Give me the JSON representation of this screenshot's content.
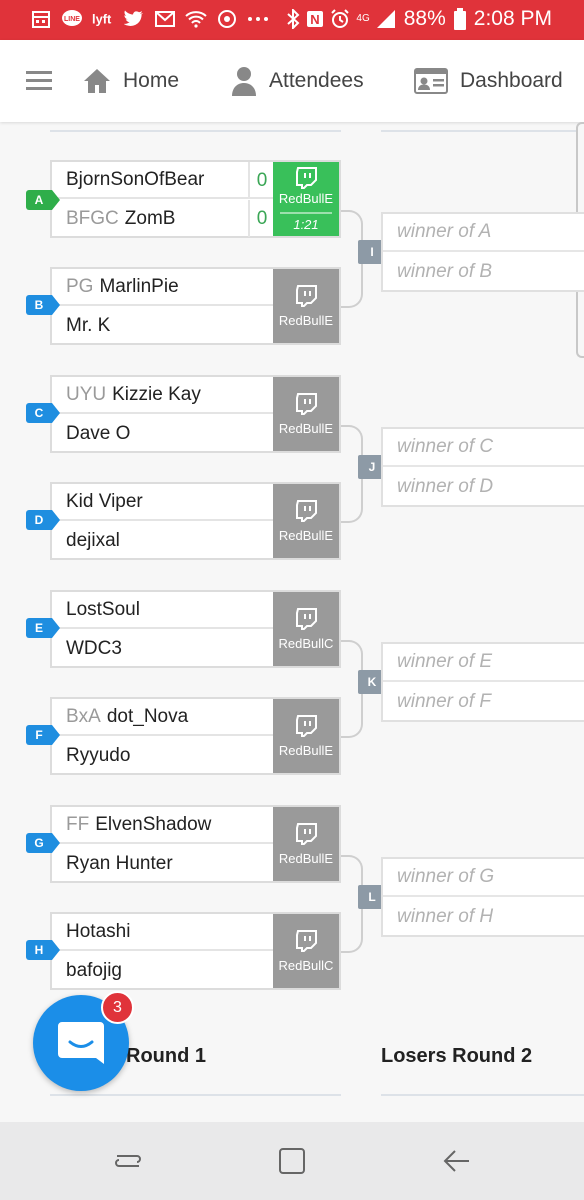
{
  "status_bar": {
    "battery": "88%",
    "time": "2:08 PM",
    "network": "4G",
    "icons": [
      "calendar-icon",
      "line-icon",
      "lyft-icon",
      "twitter-icon",
      "gmail-icon",
      "wifi-icon",
      "app-icon",
      "more-icon",
      "bluetooth-icon",
      "nfc-icon",
      "alarm-icon",
      "lte-icon",
      "signal-icon",
      "battery-icon"
    ]
  },
  "nav": {
    "menu_icon": "hamburger-icon",
    "home": "Home",
    "attendees": "Attendees",
    "dashboard": "Dashboard"
  },
  "matches": [
    {
      "id": "A",
      "badge_color": "#2fae4a",
      "p1_tag": "",
      "p1": "BjornSonOfBear",
      "p1_score": "0",
      "p2_tag": "BFGC",
      "p2": "ZomB",
      "p2_score": "0",
      "stream": "RedBullE",
      "live": true,
      "time": "1:21"
    },
    {
      "id": "B",
      "badge_color": "#1f8ee0",
      "p1_tag": "PG",
      "p1": "MarlinPie",
      "p2_tag": "",
      "p2": "Mr. K",
      "stream": "RedBullE",
      "live": false
    },
    {
      "id": "C",
      "badge_color": "#1f8ee0",
      "p1_tag": "UYU",
      "p1": "Kizzie Kay",
      "p2_tag": "",
      "p2": "Dave O",
      "stream": "RedBullE",
      "live": false
    },
    {
      "id": "D",
      "badge_color": "#1f8ee0",
      "p1_tag": "",
      "p1": "Kid Viper",
      "p2_tag": "",
      "p2": "dejixal",
      "stream": "RedBullE",
      "live": false
    },
    {
      "id": "E",
      "badge_color": "#1f8ee0",
      "p1_tag": "",
      "p1": "LostSoul",
      "p2_tag": "",
      "p2": "WDC3",
      "stream": "RedBullC",
      "live": false
    },
    {
      "id": "F",
      "badge_color": "#1f8ee0",
      "p1_tag": "BxA",
      "p1": "dot_Nova",
      "p2_tag": "",
      "p2": "Ryyudo",
      "stream": "RedBullE",
      "live": false
    },
    {
      "id": "G",
      "badge_color": "#1f8ee0",
      "p1_tag": "FF",
      "p1": "ElvenShadow",
      "p2_tag": "",
      "p2": "Ryan Hunter",
      "stream": "RedBullE",
      "live": false
    },
    {
      "id": "H",
      "badge_color": "#1f8ee0",
      "p1_tag": "",
      "p1": "Hotashi",
      "p2_tag": "",
      "p2": "bafojig",
      "stream": "RedBullC",
      "live": false
    }
  ],
  "round2": [
    {
      "id": "I",
      "p1": "winner of A",
      "p2": "winner of B"
    },
    {
      "id": "J",
      "p1": "winner of C",
      "p2": "winner of D"
    },
    {
      "id": "K",
      "p1": "winner of E",
      "p2": "winner of F"
    },
    {
      "id": "L",
      "p1": "winner of G",
      "p2": "winner of H"
    }
  ],
  "round_titles": {
    "round1": "Round 1",
    "round2": "Losers Round 2"
  },
  "chat": {
    "unread": "3",
    "icon": "chat-icon"
  },
  "system_nav": {
    "recents": "recents-icon",
    "home": "home-square-icon",
    "back": "back-icon"
  }
}
